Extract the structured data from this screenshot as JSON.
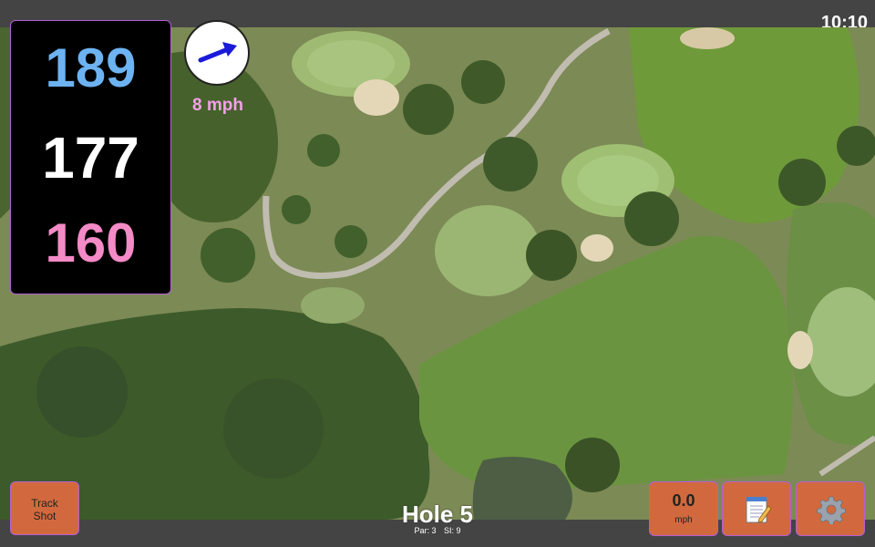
{
  "status": {
    "time": "10:10"
  },
  "distances": {
    "back": "189",
    "middle": "177",
    "front": "160"
  },
  "wind": {
    "speed": "8 mph",
    "icon": "wind-direction-arrow-icon"
  },
  "buttons": {
    "track_line1": "Track",
    "track_line2": "Shot",
    "speed_value": "0.0",
    "speed_unit": "mph",
    "notes_icon": "notepad-icon",
    "settings_icon": "gear-icon"
  },
  "hole": {
    "title": "Hole 5",
    "par": "Par: 3",
    "si": "SI: 9"
  },
  "colors": {
    "back": "#6db3f2",
    "middle": "#ffffff",
    "front": "#f48ac6",
    "button": "#d2693e",
    "accent": "#b55fd6"
  }
}
